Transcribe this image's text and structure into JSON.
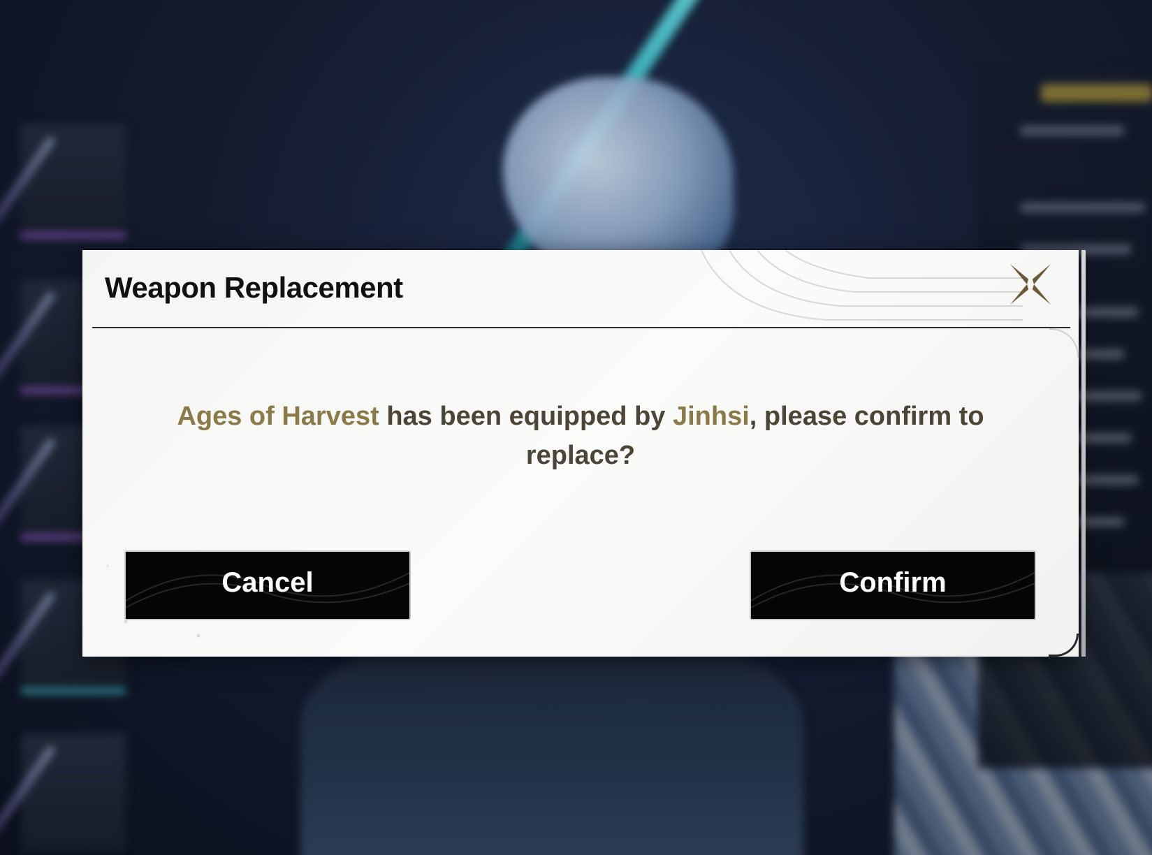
{
  "dialog": {
    "title": "Weapon Replacement",
    "message": {
      "weapon_name": "Ages of Harvest",
      "text_mid": " has been equipped by ",
      "character_name": "Jinhsi",
      "text_end": ", please confirm to replace?"
    },
    "cancel_label": "Cancel",
    "confirm_label": "Confirm",
    "close_icon": "close-icon"
  },
  "colors": {
    "highlight": "#8a7a48",
    "message_text": "#4a4536",
    "button_bg": "#050505",
    "dialog_bg": "#f5f5f4",
    "close_icon": "#6b5a35"
  }
}
